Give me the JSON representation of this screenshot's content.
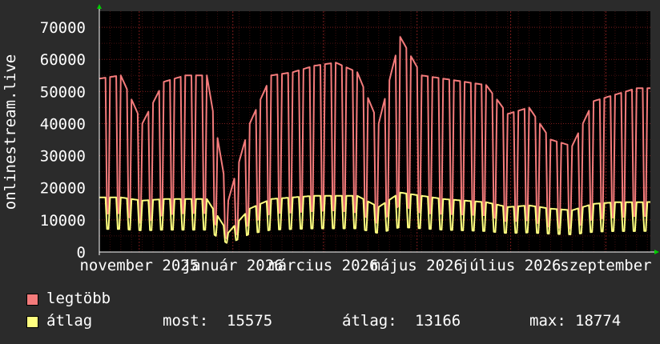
{
  "colors": {
    "background": "#2b2b2b",
    "plot_area": "#000000",
    "grid": "#8a2020",
    "axis": "#ffffff",
    "arrow": "#00cc00",
    "max_series": "#f47b7b",
    "avg_series": "#ffff80"
  },
  "legend": {
    "max_label": "legtöbb",
    "avg_label": "átlag",
    "stats": [
      {
        "label": "most:",
        "value": "15575"
      },
      {
        "label": "átlag:",
        "value": "13166"
      },
      {
        "label": "max:",
        "value": "18774"
      }
    ]
  },
  "chart_data": {
    "type": "line",
    "ylabel": "onlinestream.live",
    "ylim": [
      0,
      75000
    ],
    "y_ticks": [
      0,
      10000,
      20000,
      30000,
      40000,
      50000,
      60000,
      70000
    ],
    "y_tick_labels": [
      "0",
      "10000",
      "20000",
      "30000",
      "40000",
      "50000",
      "60000",
      "70000"
    ],
    "x_range": [
      "2025-10-06",
      "2026-09-30"
    ],
    "x_tick_labels": [
      {
        "date": "2025-11-01",
        "label": "november 2025"
      },
      {
        "date": "2026-01-01",
        "label": "január 2026"
      },
      {
        "date": "2026-03-01",
        "label": "március 2026"
      },
      {
        "date": "2026-05-01",
        "label": "május 2026"
      },
      {
        "date": "2026-07-01",
        "label": "július 2026"
      },
      {
        "date": "2026-09-01",
        "label": "szeptember"
      }
    ],
    "series": [
      {
        "name": "legtöbb",
        "x": [
          "2025-10-06",
          "2025-10-20",
          "2025-11-03",
          "2025-11-17",
          "2025-12-01",
          "2025-12-15",
          "2025-12-29",
          "2026-01-12",
          "2026-01-26",
          "2026-02-09",
          "2026-02-23",
          "2026-03-09",
          "2026-03-23",
          "2026-04-06",
          "2026-04-20",
          "2026-05-04",
          "2026-05-18",
          "2026-06-01",
          "2026-06-15",
          "2026-06-29",
          "2026-07-13",
          "2026-07-27",
          "2026-08-10",
          "2026-08-24",
          "2026-09-07",
          "2026-09-21",
          "2026-09-30"
        ],
        "values": [
          54000,
          55000,
          40000,
          53000,
          55000,
          55000,
          16000,
          40000,
          55000,
          56000,
          58000,
          59000,
          56000,
          40000,
          67000,
          55000,
          54000,
          53000,
          52000,
          43000,
          45000,
          35000,
          33000,
          47000,
          49000,
          51000,
          51000
        ]
      },
      {
        "name": "átlag",
        "x": [
          "2025-10-06",
          "2025-10-20",
          "2025-11-03",
          "2025-11-17",
          "2025-12-01",
          "2025-12-15",
          "2025-12-29",
          "2026-01-12",
          "2026-01-26",
          "2026-02-09",
          "2026-02-23",
          "2026-03-09",
          "2026-03-23",
          "2026-04-06",
          "2026-04-20",
          "2026-05-04",
          "2026-05-18",
          "2026-06-01",
          "2026-06-15",
          "2026-06-29",
          "2026-07-13",
          "2026-07-27",
          "2026-08-10",
          "2026-08-24",
          "2026-09-07",
          "2026-09-21",
          "2026-09-30"
        ],
        "values": [
          17000,
          17000,
          16000,
          16500,
          16500,
          16500,
          6000,
          13500,
          16500,
          17000,
          17500,
          17500,
          17500,
          14000,
          18500,
          17500,
          16500,
          16000,
          15500,
          14000,
          14500,
          13500,
          13000,
          15000,
          15500,
          15500,
          15575
        ]
      }
    ]
  }
}
